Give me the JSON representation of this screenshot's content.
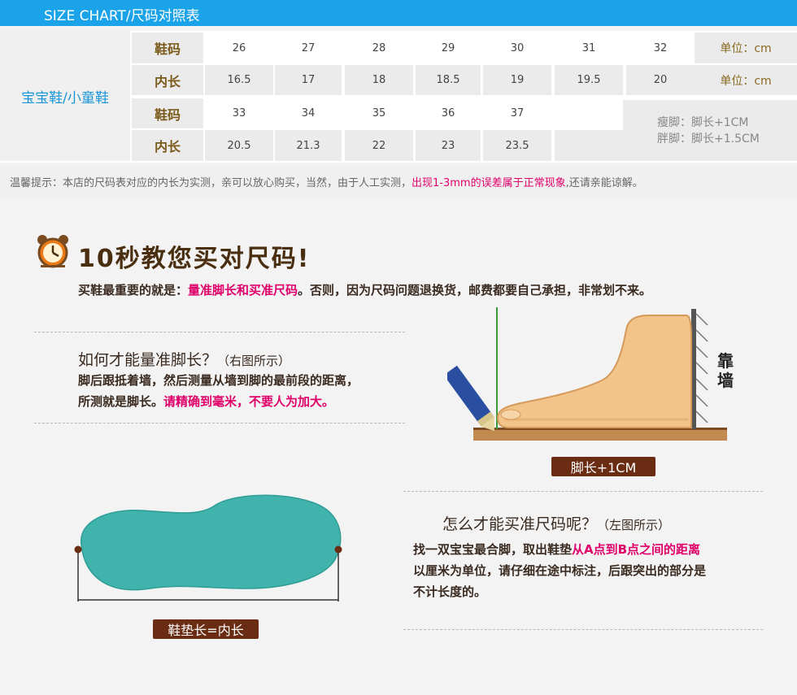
{
  "header": {
    "title": "SIZE CHART/尺码对照表"
  },
  "size_table": {
    "side_label": "宝宝鞋/小童鞋",
    "row_size_label": "鞋码",
    "row_length_label": "内长",
    "row1_sizes": [
      "26",
      "27",
      "28",
      "29",
      "30",
      "31",
      "32"
    ],
    "row1_lengths": [
      "16.5",
      "17",
      "18",
      "18.5",
      "19",
      "19.5",
      "20"
    ],
    "row2_sizes": [
      "33",
      "34",
      "35",
      "36",
      "37"
    ],
    "row2_lengths": [
      "20.5",
      "21.3",
      "22",
      "23",
      "23.5"
    ],
    "unit_label": "单位：cm",
    "note_thin": "瘦脚：脚长+1CM",
    "note_fat": "胖脚：脚长+1.5CM"
  },
  "tip": {
    "prefix": "温馨提示：本店的尺码表对应的内长为实测，亲可以放心购买，当然，由于人工实测，",
    "highlight": "出现1-3mm的误差属于正常现象",
    "suffix": ",还请亲能谅解。"
  },
  "tutorial": {
    "title": "10秒教您买对尺码!",
    "intro_prefix": "买鞋最重要的就是：",
    "intro_highlight": "量准脚长和买准尺码",
    "intro_suffix": "。否则，因为尺码问题退换货，邮费都要自己承担，非常划不来。",
    "q1_title": "如何才能量准脚长？",
    "q1_note": "（右图所示）",
    "q1_line1": "脚后跟抵着墙，然后测量从墙到脚的最前段的距离，",
    "q1_line2_prefix": "所测就是脚长。",
    "q1_line2_highlight": "请精确到毫米，不要人为加大。",
    "wall_label": "靠墙",
    "foot_badge": "脚长+1CM",
    "q2_title": "怎么才能买准尺码呢？",
    "q2_note": "（左图所示）",
    "q2_line1_prefix": "找一双宝宝最合脚，取出鞋垫",
    "q2_line1_highlight": "从A点到B点之间的距离",
    "q2_line2": "以厘米为单位，请仔细在途中标注，后跟突出的部分是",
    "q2_line3": "不计长度的。",
    "insole_badge": "鞋垫长=内长"
  },
  "colors": {
    "header_blue": "#1aa3e8",
    "accent_pink": "#e0006a",
    "badge_brown": "#6a2c12",
    "insole_teal": "#3fb3ac"
  },
  "icons": [
    "alarm-clock-icon"
  ]
}
